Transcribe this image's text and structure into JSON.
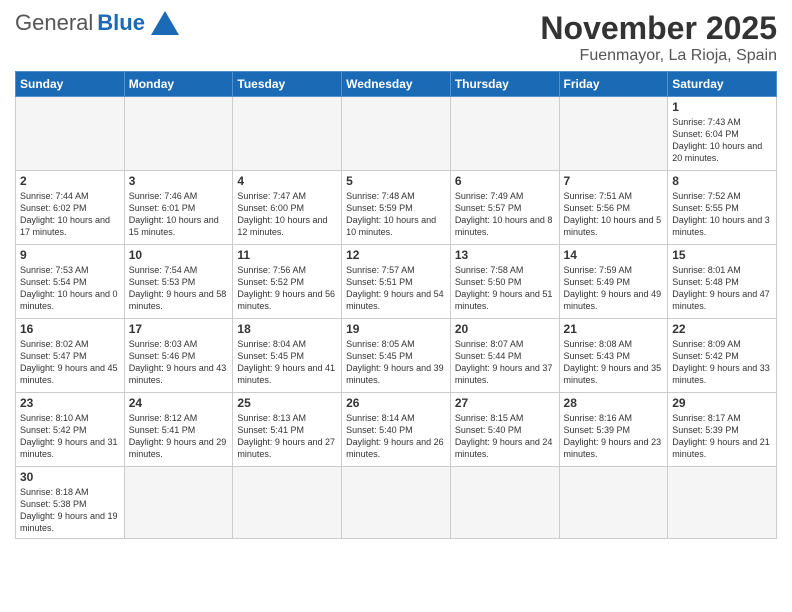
{
  "logo": {
    "general": "General",
    "blue": "Blue"
  },
  "title": "November 2025",
  "location": "Fuenmayor, La Rioja, Spain",
  "days_of_week": [
    "Sunday",
    "Monday",
    "Tuesday",
    "Wednesday",
    "Thursday",
    "Friday",
    "Saturday"
  ],
  "weeks": [
    [
      {
        "day": "",
        "info": ""
      },
      {
        "day": "",
        "info": ""
      },
      {
        "day": "",
        "info": ""
      },
      {
        "day": "",
        "info": ""
      },
      {
        "day": "",
        "info": ""
      },
      {
        "day": "",
        "info": ""
      },
      {
        "day": "1",
        "info": "Sunrise: 7:43 AM\nSunset: 6:04 PM\nDaylight: 10 hours and 20 minutes."
      }
    ],
    [
      {
        "day": "2",
        "info": "Sunrise: 7:44 AM\nSunset: 6:02 PM\nDaylight: 10 hours and 17 minutes."
      },
      {
        "day": "3",
        "info": "Sunrise: 7:46 AM\nSunset: 6:01 PM\nDaylight: 10 hours and 15 minutes."
      },
      {
        "day": "4",
        "info": "Sunrise: 7:47 AM\nSunset: 6:00 PM\nDaylight: 10 hours and 12 minutes."
      },
      {
        "day": "5",
        "info": "Sunrise: 7:48 AM\nSunset: 5:59 PM\nDaylight: 10 hours and 10 minutes."
      },
      {
        "day": "6",
        "info": "Sunrise: 7:49 AM\nSunset: 5:57 PM\nDaylight: 10 hours and 8 minutes."
      },
      {
        "day": "7",
        "info": "Sunrise: 7:51 AM\nSunset: 5:56 PM\nDaylight: 10 hours and 5 minutes."
      },
      {
        "day": "8",
        "info": "Sunrise: 7:52 AM\nSunset: 5:55 PM\nDaylight: 10 hours and 3 minutes."
      }
    ],
    [
      {
        "day": "9",
        "info": "Sunrise: 7:53 AM\nSunset: 5:54 PM\nDaylight: 10 hours and 0 minutes."
      },
      {
        "day": "10",
        "info": "Sunrise: 7:54 AM\nSunset: 5:53 PM\nDaylight: 9 hours and 58 minutes."
      },
      {
        "day": "11",
        "info": "Sunrise: 7:56 AM\nSunset: 5:52 PM\nDaylight: 9 hours and 56 minutes."
      },
      {
        "day": "12",
        "info": "Sunrise: 7:57 AM\nSunset: 5:51 PM\nDaylight: 9 hours and 54 minutes."
      },
      {
        "day": "13",
        "info": "Sunrise: 7:58 AM\nSunset: 5:50 PM\nDaylight: 9 hours and 51 minutes."
      },
      {
        "day": "14",
        "info": "Sunrise: 7:59 AM\nSunset: 5:49 PM\nDaylight: 9 hours and 49 minutes."
      },
      {
        "day": "15",
        "info": "Sunrise: 8:01 AM\nSunset: 5:48 PM\nDaylight: 9 hours and 47 minutes."
      }
    ],
    [
      {
        "day": "16",
        "info": "Sunrise: 8:02 AM\nSunset: 5:47 PM\nDaylight: 9 hours and 45 minutes."
      },
      {
        "day": "17",
        "info": "Sunrise: 8:03 AM\nSunset: 5:46 PM\nDaylight: 9 hours and 43 minutes."
      },
      {
        "day": "18",
        "info": "Sunrise: 8:04 AM\nSunset: 5:45 PM\nDaylight: 9 hours and 41 minutes."
      },
      {
        "day": "19",
        "info": "Sunrise: 8:05 AM\nSunset: 5:45 PM\nDaylight: 9 hours and 39 minutes."
      },
      {
        "day": "20",
        "info": "Sunrise: 8:07 AM\nSunset: 5:44 PM\nDaylight: 9 hours and 37 minutes."
      },
      {
        "day": "21",
        "info": "Sunrise: 8:08 AM\nSunset: 5:43 PM\nDaylight: 9 hours and 35 minutes."
      },
      {
        "day": "22",
        "info": "Sunrise: 8:09 AM\nSunset: 5:42 PM\nDaylight: 9 hours and 33 minutes."
      }
    ],
    [
      {
        "day": "23",
        "info": "Sunrise: 8:10 AM\nSunset: 5:42 PM\nDaylight: 9 hours and 31 minutes."
      },
      {
        "day": "24",
        "info": "Sunrise: 8:12 AM\nSunset: 5:41 PM\nDaylight: 9 hours and 29 minutes."
      },
      {
        "day": "25",
        "info": "Sunrise: 8:13 AM\nSunset: 5:41 PM\nDaylight: 9 hours and 27 minutes."
      },
      {
        "day": "26",
        "info": "Sunrise: 8:14 AM\nSunset: 5:40 PM\nDaylight: 9 hours and 26 minutes."
      },
      {
        "day": "27",
        "info": "Sunrise: 8:15 AM\nSunset: 5:40 PM\nDaylight: 9 hours and 24 minutes."
      },
      {
        "day": "28",
        "info": "Sunrise: 8:16 AM\nSunset: 5:39 PM\nDaylight: 9 hours and 23 minutes."
      },
      {
        "day": "29",
        "info": "Sunrise: 8:17 AM\nSunset: 5:39 PM\nDaylight: 9 hours and 21 minutes."
      }
    ],
    [
      {
        "day": "30",
        "info": "Sunrise: 8:18 AM\nSunset: 5:38 PM\nDaylight: 9 hours and 19 minutes."
      },
      {
        "day": "",
        "info": ""
      },
      {
        "day": "",
        "info": ""
      },
      {
        "day": "",
        "info": ""
      },
      {
        "day": "",
        "info": ""
      },
      {
        "day": "",
        "info": ""
      },
      {
        "day": "",
        "info": ""
      }
    ]
  ]
}
